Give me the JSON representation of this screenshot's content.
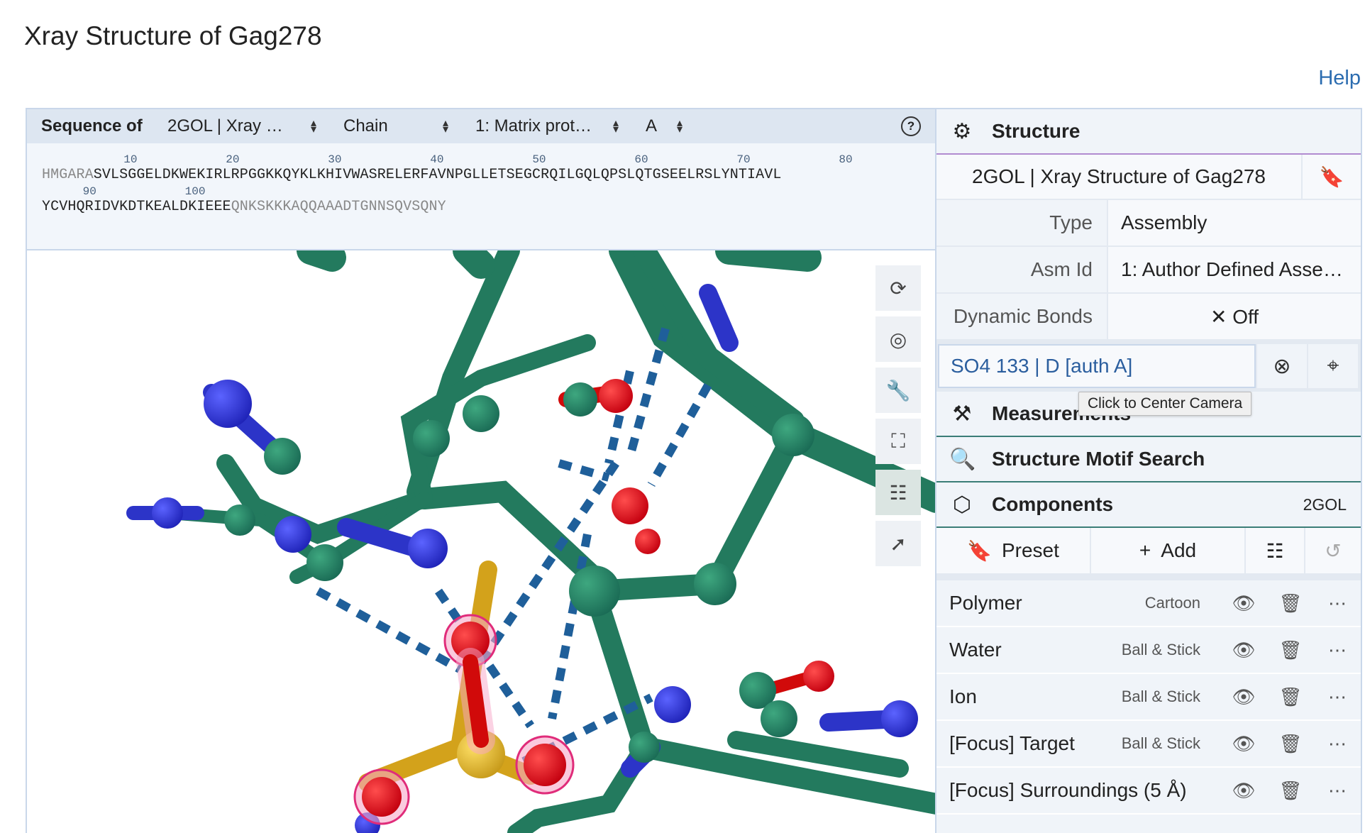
{
  "page": {
    "title": "Xray Structure of Gag278",
    "help_label": "Help"
  },
  "sequence": {
    "label": "Sequence of",
    "selects": [
      {
        "value": "2GOL | Xray …"
      },
      {
        "value": "Chain"
      },
      {
        "value": "1: Matrix prot…"
      },
      {
        "value": "A"
      }
    ],
    "help_icon": "?",
    "line1_numbers": "            10             20             30             40             50             60             70             80",
    "line1_dim": "HMGARA",
    "line1_main": "SVLSGGELDKWEKIRLRPGGKKQYKLKHIVWASRELERFAVNPGLLETSEGCRQILGQLQPSLQTGSEELRSLYNTIAVL",
    "line2_numbers": "      90             100",
    "line2_main": "YCVHQRIDVKDTKEALDKIEEE",
    "line2_dim": "QNKSKKKAQQAAADTGNNSQVSQNY"
  },
  "viewport": {
    "toolbar": [
      {
        "icon": "reset-camera-icon",
        "glyph": "⟳"
      },
      {
        "icon": "screenshot-icon",
        "glyph": "◎"
      },
      {
        "icon": "wrench-icon",
        "glyph": "🔧"
      },
      {
        "icon": "fullscreen-icon",
        "glyph": "⛶"
      },
      {
        "icon": "settings-sliders-icon",
        "glyph": "☷"
      },
      {
        "icon": "selection-mode-icon",
        "glyph": "➚"
      }
    ]
  },
  "structure": {
    "header": "Structure",
    "title": "2GOL | Xray Structure of Gag278",
    "rows": [
      {
        "label": "Type",
        "value": "Assembly"
      },
      {
        "label": "Asm Id",
        "value": "1: Author Defined Asse…"
      },
      {
        "label": "Dynamic Bonds",
        "value": "✕  Off"
      }
    ],
    "focus": {
      "value": "SO4 133 | D [auth A]",
      "tooltip": "Click to Center Camera"
    }
  },
  "measurements": {
    "header": "Measurements"
  },
  "motif_search": {
    "header": "Structure Motif Search"
  },
  "components": {
    "header": "Components",
    "id": "2GOL",
    "toolbar": {
      "preset": "Preset",
      "add": "Add"
    },
    "items": [
      {
        "name": "Polymer",
        "repr": "Cartoon"
      },
      {
        "name": "Water",
        "repr": "Ball & Stick"
      },
      {
        "name": "Ion",
        "repr": "Ball & Stick"
      },
      {
        "name": "[Focus] Target",
        "repr": "Ball & Stick"
      },
      {
        "name": "[Focus] Surroundings (5 Å)",
        "repr": ""
      }
    ]
  }
}
